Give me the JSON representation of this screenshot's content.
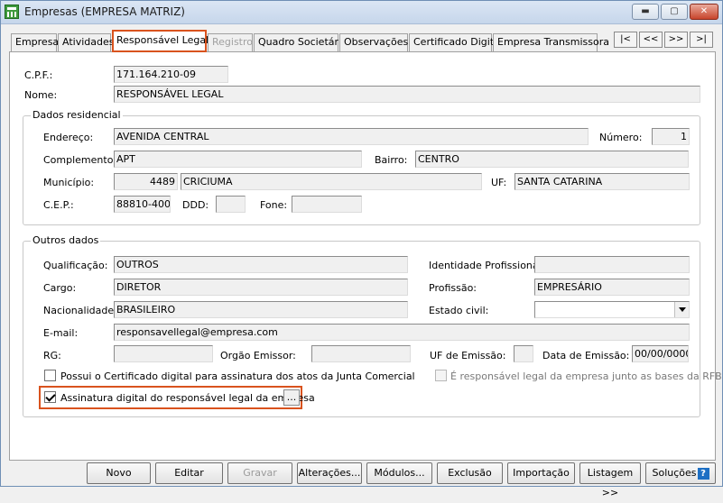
{
  "window": {
    "title": "Empresas (EMPRESA MATRIZ)",
    "minimize": "▬",
    "maximize": "▢",
    "close": "✕"
  },
  "tabs": [
    {
      "label": "Empresa"
    },
    {
      "label": "Atividades"
    },
    {
      "label": "Responsável Legal"
    },
    {
      "label": "Registro"
    },
    {
      "label": "Quadro Societário"
    },
    {
      "label": "Observações"
    },
    {
      "label": "Certificado Digital"
    },
    {
      "label": "Empresa Transmissora"
    }
  ],
  "nav": {
    "first": "|<",
    "prev": "<<",
    "next": ">>",
    "last": ">|"
  },
  "form": {
    "cpf_label": "C.P.F.:",
    "cpf_value": "171.164.210-09",
    "nome_label": "Nome:",
    "nome_value": "RESPONSÁVEL LEGAL",
    "residencial": {
      "title": "Dados residencial",
      "endereco_label": "Endereço:",
      "endereco_value": "AVENIDA CENTRAL",
      "numero_label": "Número:",
      "numero_value": "1",
      "complemento_label": "Complemento:",
      "complemento_value": "APT",
      "bairro_label": "Bairro:",
      "bairro_value": "CENTRO",
      "municipio_label": "Município:",
      "municipio_code": "4489",
      "municipio_value": "CRICIUMA",
      "uf_label": "UF:",
      "uf_value": "SANTA CATARINA",
      "cep_label": "C.E.P.:",
      "cep_value": "88810-400",
      "ddd_label": "DDD:",
      "ddd_value": "",
      "fone_label": "Fone:",
      "fone_value": ""
    },
    "outros": {
      "title": "Outros dados",
      "qualificacao_label": "Qualificação:",
      "qualificacao_value": "OUTROS",
      "identidade_label": "Identidade Profissional:",
      "identidade_value": "",
      "cargo_label": "Cargo:",
      "cargo_value": "DIRETOR",
      "profissao_label": "Profissão:",
      "profissao_value": "EMPRESÁRIO",
      "nacionalidade_label": "Nacionalidade:",
      "nacionalidade_value": "BRASILEIRO",
      "estado_civil_label": "Estado civil:",
      "estado_civil_value": "",
      "email_label": "E-mail:",
      "email_value": "responsavellegal@empresa.com",
      "rg_label": "RG:",
      "rg_value": "",
      "orgao_label": "Orgão Emissor:",
      "orgao_value": "",
      "uf_emissao_label": "UF de Emissão:",
      "uf_emissao_value": "",
      "data_emissao_label": "Data de Emissão:",
      "data_emissao_value": "00/00/0000",
      "certificado_junta_label": "Possui o Certificado digital para assinatura dos atos da Junta Comercial",
      "responsavel_rfb_label": "É responsável legal da empresa junto as bases da RFB",
      "assinatura_label": "Assinatura digital do responsável legal da empresa",
      "assinatura_button": "..."
    }
  },
  "toolbar": {
    "novo": "Novo",
    "editar": "Editar",
    "gravar": "Gravar",
    "alteracoes": "Alterações...",
    "modulos": "Módulos...",
    "exclusao": "Exclusão",
    "importacao": "Importação",
    "listagem": "Listagem >>",
    "solucoes": "Soluções",
    "help_glyph": "?"
  }
}
